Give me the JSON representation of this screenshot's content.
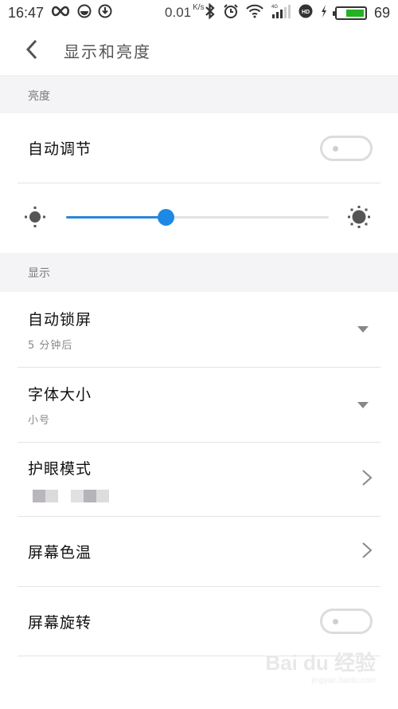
{
  "status_bar": {
    "time": "16:47",
    "net_speed": "0.01",
    "net_speed_unit": "K/s",
    "network_type": "4G",
    "battery_level": "69",
    "battery_fraction": 0.69,
    "battery_color": "#22b322",
    "icons": [
      "infinity-icon",
      "data-saver-icon",
      "download-icon",
      "bluetooth-icon",
      "alarm-icon",
      "wifi-icon",
      "signal-icon",
      "hd-icon",
      "charging-icon",
      "battery-icon"
    ]
  },
  "header": {
    "back_icon": "chevron-left-icon",
    "title": "显示和亮度"
  },
  "sections": {
    "brightness": {
      "label": "亮度",
      "auto_adjust": {
        "title": "自动调节",
        "enabled": false
      },
      "slider": {
        "value": 0.38,
        "min_icon": "brightness-low-icon",
        "max_icon": "brightness-high-icon",
        "accent": "#1e88e5"
      }
    },
    "display": {
      "label": "显示",
      "items": [
        {
          "title": "自动锁屏",
          "subtitle": "5 分钟后",
          "action": "dropdown"
        },
        {
          "title": "字体大小",
          "subtitle": "小号",
          "action": "dropdown"
        },
        {
          "title": "护眼模式",
          "subtitle": "",
          "action": "chevron",
          "subtitle_obscured": true
        },
        {
          "title": "屏幕色温",
          "action": "chevron"
        },
        {
          "title": "屏幕旋转",
          "action": "toggle",
          "enabled": false
        }
      ]
    }
  },
  "watermark": {
    "brand": "Bai du 经验",
    "url": "jingyan.baidu.com"
  }
}
